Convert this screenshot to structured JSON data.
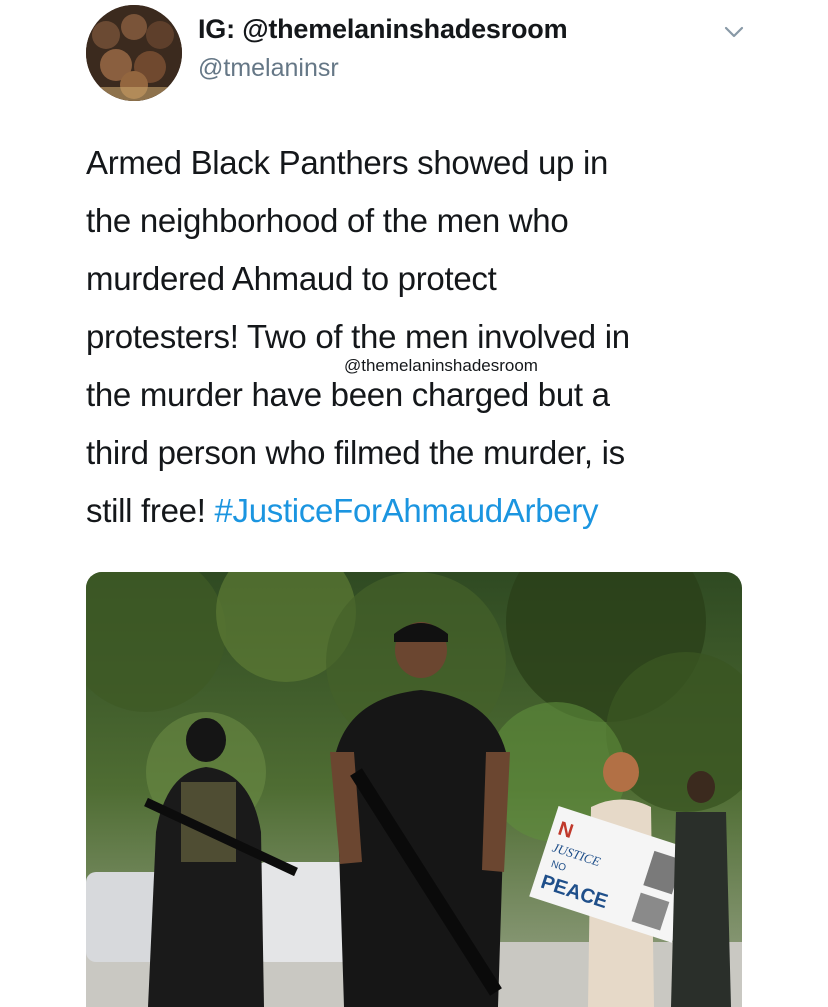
{
  "tweet": {
    "display_name": "IG: @themelaninshadesroom",
    "handle": "@tmelaninsr",
    "text_lines": [
      "Armed Black Panthers showed up in",
      "the neighborhood of the men who",
      "murdered Ahmaud to protect",
      "protesters! Two of the men involved in",
      "the murder have been charged but a",
      "third person who filmed the murder, is",
      "still free! "
    ],
    "hashtag": "#JusticeForAhmaudArbery",
    "watermark": "@themelaninshadesroom",
    "hashtag_color": "#1b95e0",
    "handle_color": "#657786",
    "chevron_icon": "chevron-down-icon"
  },
  "media": {
    "sign_lines": [
      "N",
      "JUSTICE",
      "NO",
      "PEACE"
    ]
  }
}
